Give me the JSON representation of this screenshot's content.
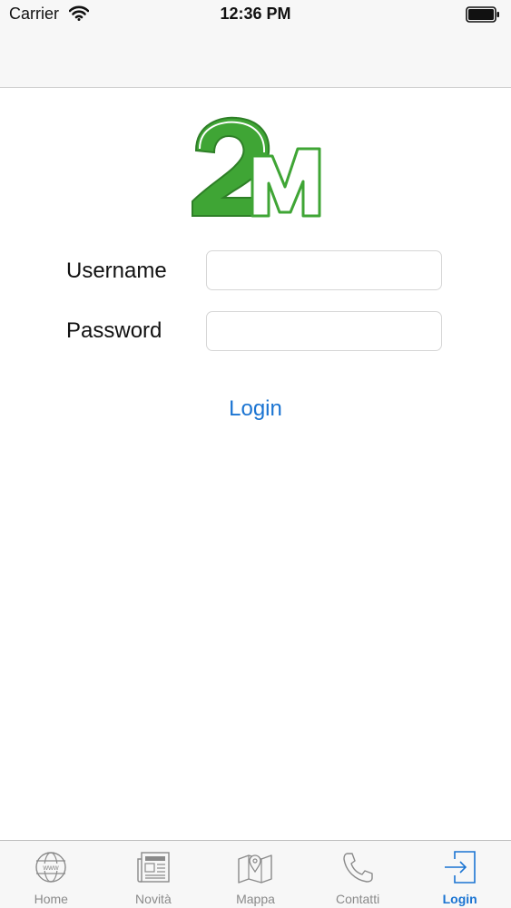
{
  "status_bar": {
    "carrier": "Carrier",
    "time": "12:36 PM"
  },
  "logo": {
    "text": "2M",
    "icon": "2m-logo",
    "colors": {
      "green": "#3fa535"
    }
  },
  "form": {
    "username_label": "Username",
    "username_value": "",
    "password_label": "Password",
    "password_value": "",
    "login_button": "Login"
  },
  "tab_bar": {
    "tabs": [
      {
        "label": "Home",
        "icon": "globe-icon",
        "active": false
      },
      {
        "label": "Novità",
        "icon": "newspaper-icon",
        "active": false
      },
      {
        "label": "Mappa",
        "icon": "map-icon",
        "active": false
      },
      {
        "label": "Contatti",
        "icon": "phone-icon",
        "active": false
      },
      {
        "label": "Login",
        "icon": "login-icon",
        "active": true
      }
    ]
  },
  "colors": {
    "accent": "#1a74d2",
    "inactive": "#8a8a8a",
    "bar_background": "#f7f7f7"
  }
}
